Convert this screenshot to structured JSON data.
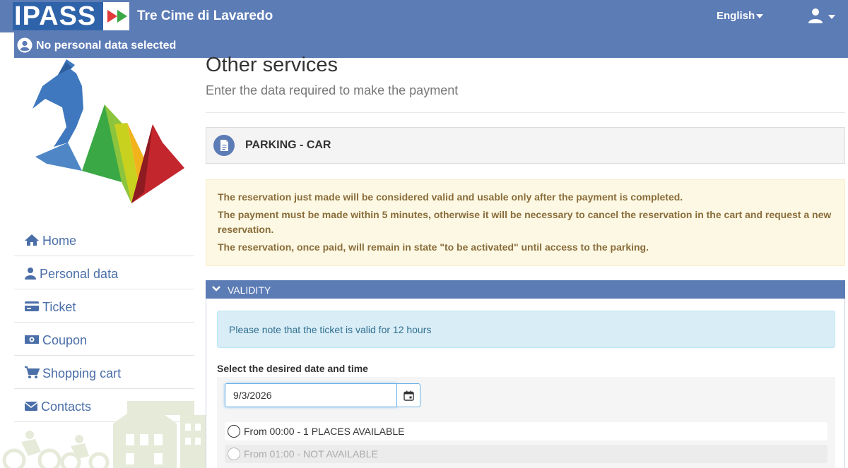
{
  "navbar": {
    "logo_text": "PASS",
    "site_title": "Tre Cime di Lavaredo",
    "language": "English"
  },
  "personal_data_bar": {
    "text": "No personal data selected"
  },
  "sidebar": {
    "items": [
      {
        "label": "Home",
        "icon": "home-icon"
      },
      {
        "label": "Personal data",
        "icon": "user-icon"
      },
      {
        "label": "Ticket",
        "icon": "credit-card-icon"
      },
      {
        "label": "Coupon",
        "icon": "money-icon"
      },
      {
        "label": "Shopping cart",
        "icon": "cart-icon"
      },
      {
        "label": "Contacts",
        "icon": "envelope-icon"
      }
    ]
  },
  "main": {
    "title": "Other services",
    "subtitle": "Enter the data required to make the payment",
    "service_title": "PARKING - CAR",
    "warnings": [
      "The reservation just made will be considered valid and usable only after the payment is completed.",
      "The payment must be made within 5 minutes, otherwise it will be necessary to cancel the reservation in the cart and request a new reservation.",
      "The reservation, once paid, will remain in state \"to be activated\" until access to the parking."
    ],
    "validity": {
      "header": "VALIDITY",
      "info": "Please note that the ticket is valid for 12 hours",
      "select_label": "Select the desired date and time",
      "date_value": "9/3/2026",
      "slots": [
        {
          "label": "From 00:00 - 1 PLACES AVAILABLE",
          "available": true
        },
        {
          "label": "From 01:00 - NOT AVAILABLE",
          "available": false
        }
      ]
    }
  },
  "colors": {
    "brand": "#5c7cb6",
    "logo_blue": "#2f63a9",
    "link": "#4a6ea8",
    "warning_bg": "#fcf8e3",
    "warning_text": "#8a6d3b",
    "info_bg": "#d9edf7",
    "info_text": "#31708f"
  }
}
